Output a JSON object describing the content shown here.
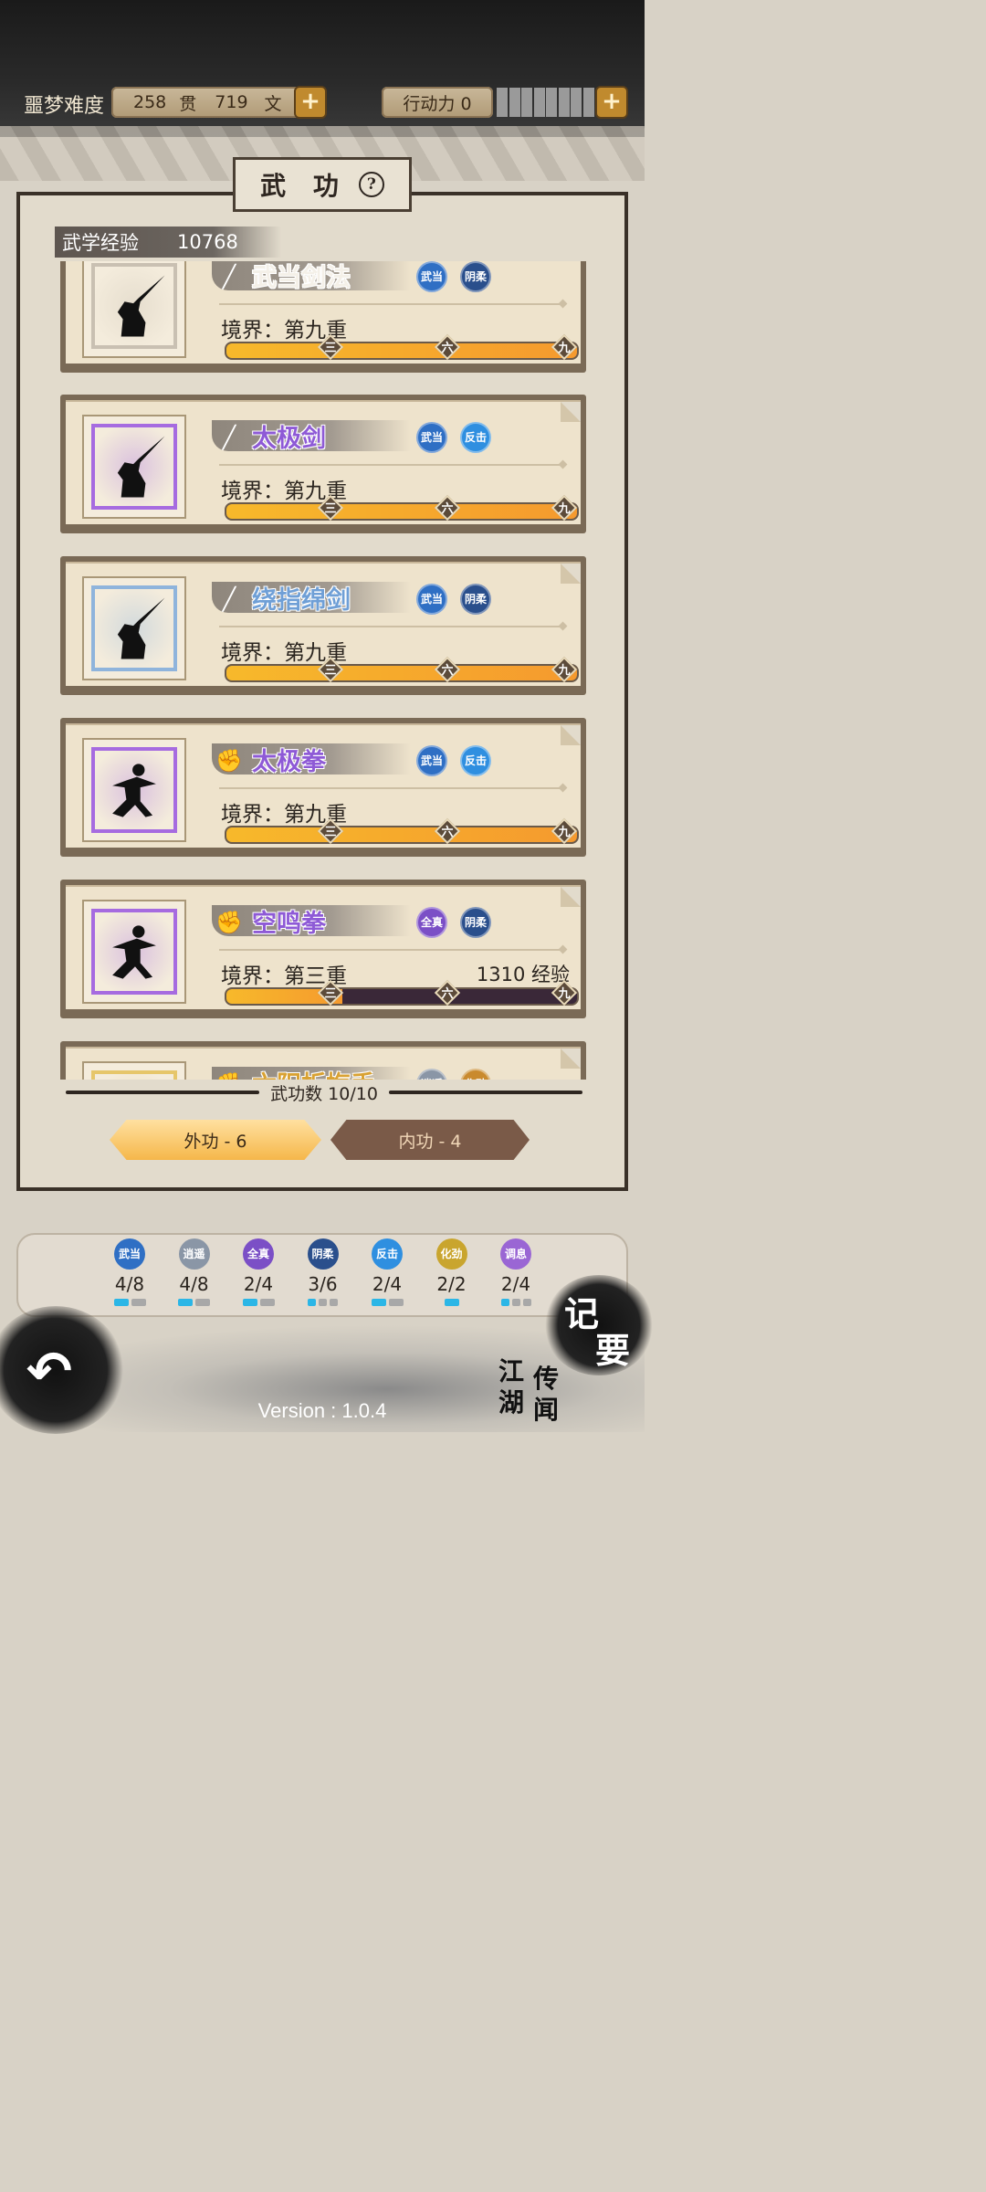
{
  "topbar": {
    "difficulty_label": "噩梦难度",
    "money": {
      "guan": "258",
      "guan_unit": "贯",
      "wen": "719",
      "wen_unit": "文"
    },
    "stamina_label": "行动力 0",
    "stamina_value": 0,
    "stamina_max_segments": 8,
    "plus_symbol": "+"
  },
  "panel": {
    "title": "武 功",
    "help_symbol": "?",
    "exp_label": "武学经验",
    "exp_value": "10768"
  },
  "skills": [
    {
      "name": "武当剑法",
      "weapon_icon": "sword-icon",
      "realm": "境界：第九重",
      "frame_color": "#c9c0b2",
      "name_color": "#f4f0e8",
      "badges": [
        {
          "text": "武当",
          "color": "#2f6fc4"
        },
        {
          "text": "阴柔",
          "color": "#2a4f8c"
        }
      ],
      "progress": 1.0,
      "need": ""
    },
    {
      "name": "太极剑",
      "weapon_icon": "sword-icon",
      "realm": "境界：第九重",
      "frame_color": "#a66be0",
      "name_color": "#8e5ad6",
      "badges": [
        {
          "text": "武当",
          "color": "#2f6fc4"
        },
        {
          "text": "反击",
          "color": "#2f8fe0"
        }
      ],
      "progress": 1.0,
      "need": ""
    },
    {
      "name": "绕指绵剑",
      "weapon_icon": "sword-icon",
      "realm": "境界：第九重",
      "frame_color": "#8fb4dc",
      "name_color": "#6f9fd6",
      "badges": [
        {
          "text": "武当",
          "color": "#2f6fc4"
        },
        {
          "text": "阴柔",
          "color": "#2a4f8c"
        }
      ],
      "progress": 1.0,
      "need": ""
    },
    {
      "name": "太极拳",
      "weapon_icon": "fist-icon",
      "realm": "境界：第九重",
      "frame_color": "#a66be0",
      "name_color": "#8e5ad6",
      "badges": [
        {
          "text": "武当",
          "color": "#2f6fc4"
        },
        {
          "text": "反击",
          "color": "#2f8fe0"
        }
      ],
      "progress": 1.0,
      "need": ""
    },
    {
      "name": "空鸣拳",
      "weapon_icon": "fist-icon",
      "realm": "境界：第三重",
      "frame_color": "#a66be0",
      "name_color": "#8e5ad6",
      "badges": [
        {
          "text": "全真",
          "color": "#7b4fc6"
        },
        {
          "text": "阴柔",
          "color": "#2a4f8c"
        }
      ],
      "progress": 0.33,
      "need": "1310 经验"
    },
    {
      "name": "六阳折梅手",
      "weapon_icon": "fist-icon",
      "realm": "",
      "frame_color": "#e6c66a",
      "name_color": "#d9a233",
      "badges": [
        {
          "text": "逍遥",
          "color": "#8a96a6"
        },
        {
          "text": "化劲",
          "color": "#c98a2e"
        }
      ],
      "progress": 0,
      "need": ""
    }
  ],
  "realm_markers": [
    "三",
    "六",
    "九"
  ],
  "skill_count": "武功数 10/10",
  "tabs": {
    "outer": "外功 - 6",
    "inner": "内功 - 4"
  },
  "stats": [
    {
      "icon": "武当",
      "color": "#2f6fc4",
      "value": "4/8",
      "pips": [
        1,
        0
      ]
    },
    {
      "icon": "逍遥",
      "color": "#8a96a6",
      "value": "4/8",
      "pips": [
        1,
        0
      ]
    },
    {
      "icon": "全真",
      "color": "#7b4fc6",
      "value": "2/4",
      "pips": [
        1,
        0
      ]
    },
    {
      "icon": "阴柔",
      "color": "#2a4f8c",
      "value": "3/6",
      "pips": [
        1,
        0,
        0
      ]
    },
    {
      "icon": "反击",
      "color": "#2f8fe0",
      "value": "2/4",
      "pips": [
        1,
        0
      ]
    },
    {
      "icon": "化劲",
      "color": "#c9a52e",
      "value": "2/2",
      "pips": [
        1
      ]
    },
    {
      "icon": "调息",
      "color": "#9a66d4",
      "value": "2/4",
      "pips": [
        1,
        0,
        0
      ]
    }
  ],
  "footer": {
    "back_icon": "back-arrow-icon",
    "jiyao": [
      "记",
      "要"
    ],
    "jianghu": [
      "江",
      "湖",
      "传",
      "闻"
    ],
    "version": "Version : 1.0.4"
  }
}
